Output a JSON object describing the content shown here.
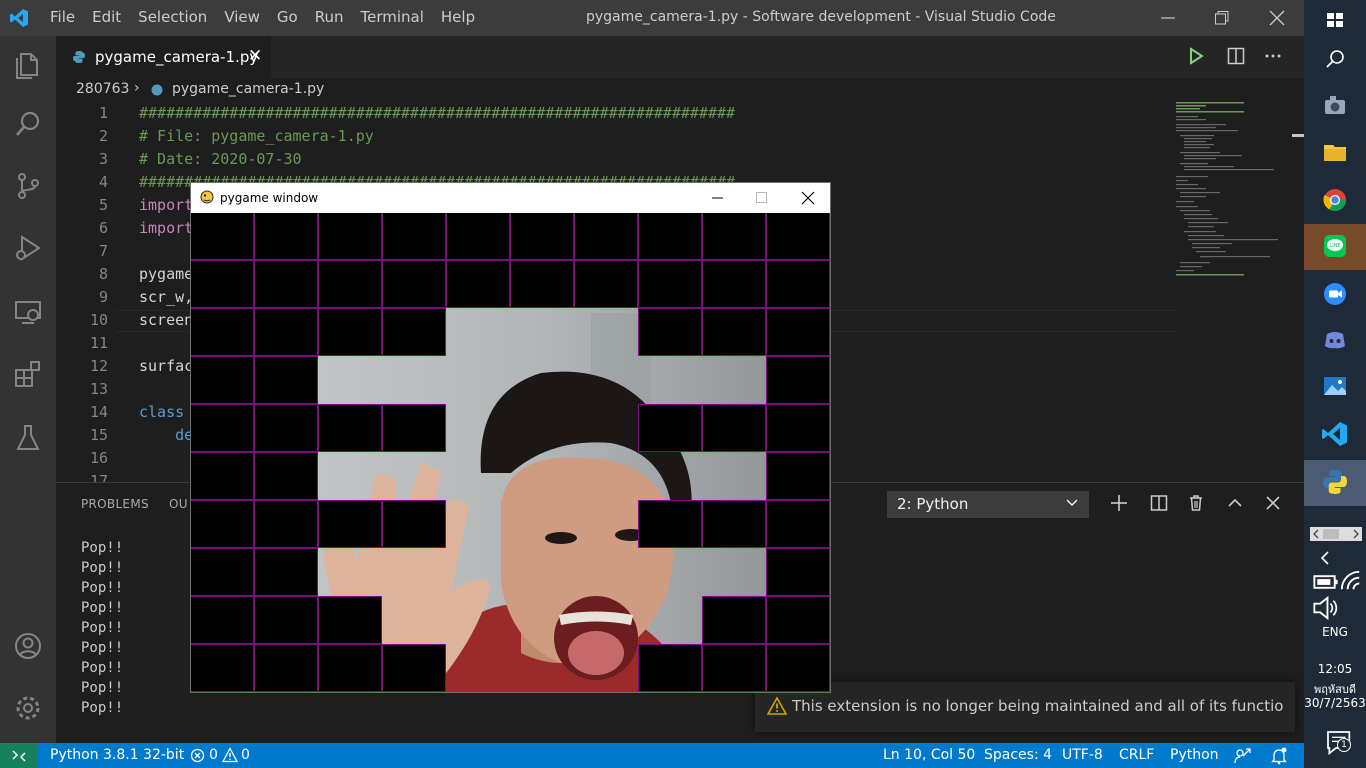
{
  "app": {
    "menu": [
      "File",
      "Edit",
      "Selection",
      "View",
      "Go",
      "Run",
      "Terminal",
      "Help"
    ],
    "window_title": "pygame_camera-1.py - Software development - Visual Studio Code"
  },
  "editor": {
    "tab_label": "pygame_camera-1.py",
    "breadcrumb": [
      "280763",
      "pygame_camera-1.py"
    ],
    "lines": [
      {
        "n": "1",
        "text": "##################################################################",
        "cls": "c-com"
      },
      {
        "n": "2",
        "text": "# File: pygame_camera-1.py",
        "cls": "c-com"
      },
      {
        "n": "3",
        "text": "# Date: 2020-07-30",
        "cls": "c-com"
      },
      {
        "n": "4",
        "text": "##################################################################",
        "cls": "c-com"
      },
      {
        "n": "5",
        "text": "import",
        "cls": "c-key"
      },
      {
        "n": "6",
        "text": "import",
        "cls": "c-key"
      },
      {
        "n": "7",
        "text": "",
        "cls": "c-txt"
      },
      {
        "n": "8",
        "text": "pygame",
        "cls": "c-txt"
      },
      {
        "n": "9",
        "text": "scr_w,",
        "cls": "c-txt"
      },
      {
        "n": "10",
        "text": "screen",
        "cls": "c-txt"
      },
      {
        "n": "11",
        "text": "",
        "cls": "c-txt"
      },
      {
        "n": "12",
        "text": "surfac",
        "cls": "c-txt"
      },
      {
        "n": "13",
        "text": "",
        "cls": "c-txt"
      },
      {
        "n": "14",
        "text": "class",
        "cls": "c-def"
      },
      {
        "n": "15",
        "text": "    de",
        "cls": "c-def"
      },
      {
        "n": "16",
        "text": "",
        "cls": "c-txt"
      },
      {
        "n": "17",
        "text": "",
        "cls": "c-txt"
      }
    ]
  },
  "panel": {
    "tabs": [
      "PROBLEMS",
      "OU"
    ],
    "terminal_select": "2: Python",
    "output": [
      "Pop!!",
      "Pop!!",
      "Pop!!",
      "Pop!!",
      "Pop!!",
      "Pop!!",
      "Pop!!",
      "Pop!!",
      "Pop!!"
    ]
  },
  "notification": {
    "message": "This extension is no longer being maintained and all of its functionalit..."
  },
  "statusbar": {
    "python": "Python 3.8.1 32-bit",
    "errors": "0",
    "warnings": "0",
    "position": "Ln 10, Col 50",
    "spaces": "Spaces: 4",
    "encoding": "UTF-8",
    "eol": "CRLF",
    "language": "Python"
  },
  "pygame": {
    "title": "pygame window",
    "black_cells": [
      [
        1,
        1,
        1,
        1,
        1,
        1,
        1,
        1,
        1,
        1
      ],
      [
        1,
        1,
        1,
        1,
        1,
        1,
        1,
        1,
        1,
        1
      ],
      [
        1,
        1,
        1,
        1,
        0,
        0,
        0,
        1,
        1,
        1
      ],
      [
        1,
        1,
        0,
        0,
        0,
        0,
        0,
        0,
        0,
        1
      ],
      [
        1,
        1,
        1,
        1,
        0,
        0,
        0,
        1,
        1,
        1
      ],
      [
        1,
        1,
        0,
        0,
        0,
        0,
        0,
        0,
        0,
        1
      ],
      [
        1,
        1,
        1,
        1,
        0,
        0,
        0,
        1,
        1,
        1
      ],
      [
        1,
        1,
        0,
        0,
        0,
        0,
        0,
        0,
        0,
        1
      ],
      [
        1,
        1,
        1,
        0,
        0,
        0,
        0,
        0,
        1,
        1
      ],
      [
        1,
        1,
        1,
        1,
        0,
        0,
        0,
        1,
        1,
        1
      ]
    ]
  },
  "taskbar": {
    "language": "ENG",
    "time": "12:05",
    "day": "พฤหัสบดี",
    "date": "30/7/2563",
    "notification_count": "1"
  },
  "colors": {
    "accent": "#007acc",
    "grid_border": "#7a0e7e"
  }
}
